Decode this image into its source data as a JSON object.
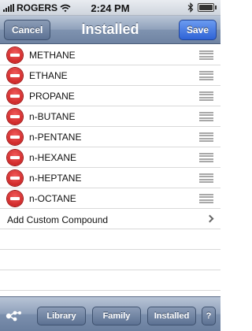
{
  "status_bar": {
    "carrier": "ROGERS",
    "time": "2:24 PM",
    "icons": [
      "signal-bars-icon",
      "wifi-icon",
      "bluetooth-icon",
      "battery-icon"
    ]
  },
  "nav": {
    "title": "Installed",
    "cancel_label": "Cancel",
    "save_label": "Save"
  },
  "compounds": [
    "METHANE",
    "ETHANE",
    "PROPANE",
    "n-BUTANE",
    "n-PENTANE",
    "n-HEXANE",
    "n-HEPTANE",
    "n-OCTANE"
  ],
  "add_custom_label": "Add Custom Compound",
  "toolbar": {
    "molecule_icon": "molecule-icon",
    "library_label": "Library",
    "family_label": "Family",
    "installed_label": "Installed",
    "help_label": "?"
  },
  "colors": {
    "nav_blue": "#8fa1bb",
    "save_blue": "#2e63d6",
    "delete_red": "#c31616"
  }
}
